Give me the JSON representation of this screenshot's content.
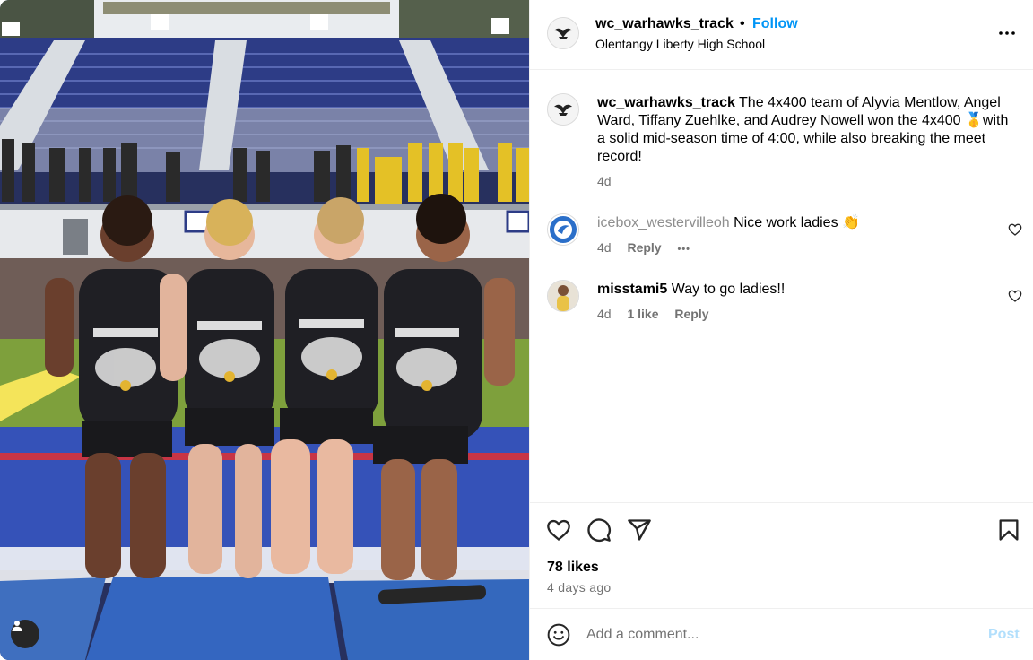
{
  "post": {
    "username": "wc_warhawks_track",
    "dot": "•",
    "follow_label": "Follow",
    "location": "Olentangy Liberty High School",
    "more_icon": "more-horizontal-icon",
    "photo_alt": "Four track athletes in Westerville Central uniforms biting gold medals in front of stadium bleachers"
  },
  "caption": {
    "username": "wc_warhawks_track",
    "text": "The 4x400 team of Alyvia Mentlow, Angel Ward, Tiffany Zuehlke, and Audrey Nowell won the 4x400 🥇with a solid mid-season time of 4:00, while also breaking the meet record!",
    "time": "4d"
  },
  "comments": [
    {
      "username": "icebox_westervilleoh",
      "text": "Nice work ladies 👏",
      "time": "4d",
      "reply_label": "Reply",
      "more_label": "•••"
    },
    {
      "username": "misstami5",
      "text": "Way to go ladies!!",
      "time": "4d",
      "likes_label": "1 like",
      "reply_label": "Reply"
    }
  ],
  "engagement": {
    "likes": "78 likes",
    "posted": "4 days ago"
  },
  "compose": {
    "placeholder": "Add a comment...",
    "post_label": "Post"
  },
  "colors": {
    "link": "#0095f6",
    "secondary_text": "#737373",
    "post_disabled": "#b2dffc",
    "divider": "#efefef"
  }
}
